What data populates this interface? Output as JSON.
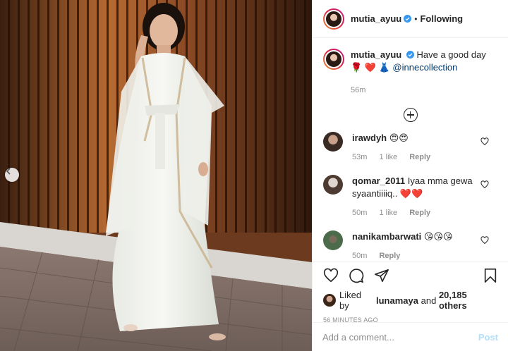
{
  "post": {
    "author": "mutia_ayuu",
    "separator": "•",
    "follow_state": "Following",
    "caption": {
      "text_part1": "Have a good day",
      "emoji_line": "🌹 ❤️ 👗",
      "mention": "@innecollection",
      "time": "56m"
    },
    "photo_alt": "Woman in white dress standing in front of wooden slat wall"
  },
  "comments": [
    {
      "user": "irawdyh",
      "text": "😍😍",
      "time": "53m",
      "likes": "1 like",
      "reply": "Reply",
      "avatar_color": "#c9a18a"
    },
    {
      "user": "qomar_2011",
      "text": "Iyaa mma gewa syaantiiiiq.. ❤️❤️",
      "time": "50m",
      "likes": "1 like",
      "reply": "Reply",
      "avatar_color": "#e1d6cf"
    },
    {
      "user": "nanikambarwati",
      "text": "😘😘😘",
      "time": "50m",
      "likes": "",
      "reply": "Reply",
      "avatar_color": "#4b6b4a"
    }
  ],
  "likes": {
    "prefix": "Liked by",
    "user": "lunamaya",
    "and": "and",
    "count": "20,185 others"
  },
  "posted_ago": "56 MINUTES AGO",
  "add_comment": {
    "placeholder": "Add a comment...",
    "post_label": "Post"
  },
  "colors": {
    "link": "#00376b",
    "muted": "#8e8e8e",
    "verified": "#3897f0",
    "post_btn": "#b2dffc"
  },
  "icons": [
    "chevron-left-icon",
    "verified-icon",
    "plus-circle-icon",
    "heart-icon",
    "comment-icon",
    "share-icon",
    "bookmark-icon"
  ]
}
